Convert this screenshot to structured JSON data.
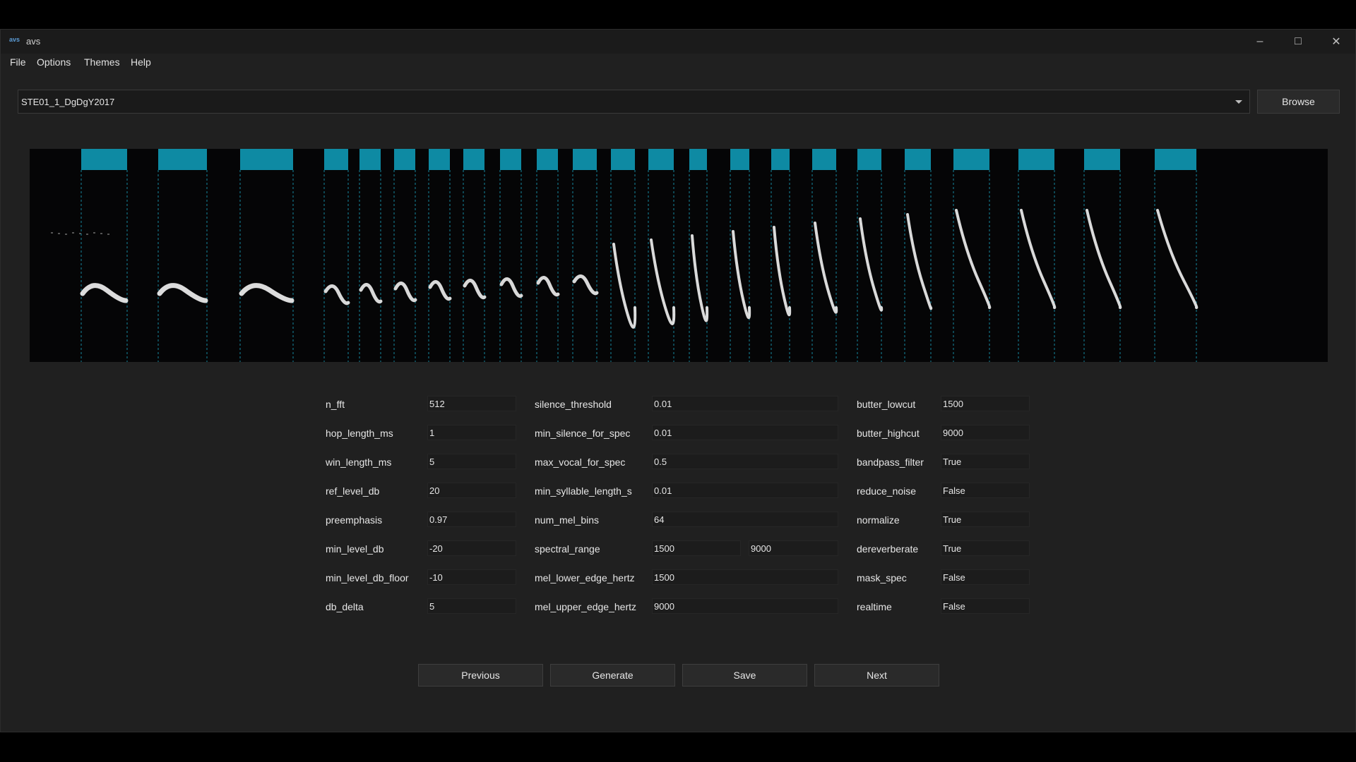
{
  "window": {
    "app_icon_text": "avs",
    "title": "avs"
  },
  "menu": {
    "items": [
      "File",
      "Options",
      "Themes",
      "Help"
    ]
  },
  "file_selector": {
    "selected": "STE01_1_DgDgY2017"
  },
  "browse_label": "Browse",
  "colors": {
    "window_bg": "#202020",
    "spectrogram_bg": "#050506",
    "segment_marker": "#0e8aa3",
    "segment_line": "#1aa7c4"
  },
  "params": {
    "col1": [
      {
        "label": "n_fft",
        "value": "512"
      },
      {
        "label": "hop_length_ms",
        "value": "1"
      },
      {
        "label": "win_length_ms",
        "value": "5"
      },
      {
        "label": "ref_level_db",
        "value": "20"
      },
      {
        "label": "preemphasis",
        "value": "0.97"
      },
      {
        "label": "min_level_db",
        "value": "-20"
      },
      {
        "label": "min_level_db_floor",
        "value": "-10"
      },
      {
        "label": "db_delta",
        "value": "5"
      }
    ],
    "col2": [
      {
        "label": "silence_threshold",
        "value": "0.01"
      },
      {
        "label": "min_silence_for_spec",
        "value": "0.01"
      },
      {
        "label": "max_vocal_for_spec",
        "value": "0.5"
      },
      {
        "label": "min_syllable_length_s",
        "value": "0.01"
      },
      {
        "label": "num_mel_bins",
        "value": "64"
      },
      {
        "label": "spectral_range",
        "value": "1500",
        "value2": "9000"
      },
      {
        "label": "mel_lower_edge_hertz",
        "value": "1500"
      },
      {
        "label": "mel_upper_edge_hertz",
        "value": "9000"
      }
    ],
    "col3": [
      {
        "label": "butter_lowcut",
        "value": "1500"
      },
      {
        "label": "butter_highcut",
        "value": "9000"
      },
      {
        "label": "bandpass_filter",
        "value": "True"
      },
      {
        "label": "reduce_noise",
        "value": "False"
      },
      {
        "label": "normalize",
        "value": "True"
      },
      {
        "label": "dereverberate",
        "value": "True"
      },
      {
        "label": "mask_spec",
        "value": "False"
      },
      {
        "label": "realtime",
        "value": "False"
      }
    ]
  },
  "actions": {
    "previous": "Previous",
    "generate": "Generate",
    "save": "Save",
    "next": "Next"
  }
}
